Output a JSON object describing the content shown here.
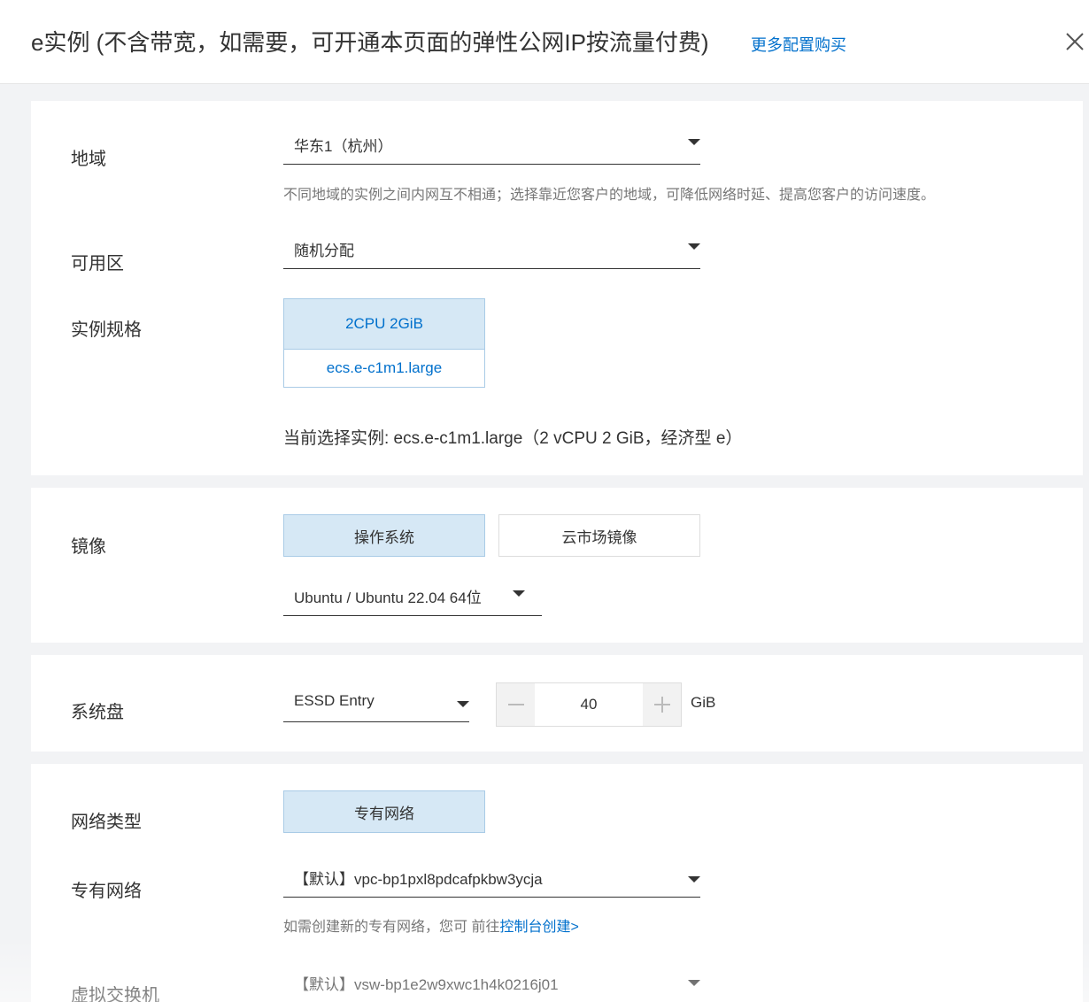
{
  "header": {
    "title": "e实例 (不含带宽，如需要，可开通本页面的弹性公网IP按流量付费)",
    "more_link": "更多配置购买",
    "close_icon": "close-icon"
  },
  "instance": {
    "region": {
      "label": "地域",
      "value": "华东1（杭州）",
      "hint": "不同地域的实例之间内网互不相通；选择靠近您客户的地域，可降低网络时延、提高您客户的访问速度。"
    },
    "zone": {
      "label": "可用区",
      "value": "随机分配"
    },
    "spec": {
      "label": "实例规格",
      "card_title": "2CPU 2GiB",
      "card_type": "ecs.e-c1m1.large",
      "current": "当前选择实例: ecs.e-c1m1.large（2 vCPU 2 GiB，经济型 e）"
    }
  },
  "image": {
    "label": "镜像",
    "tabs": [
      {
        "label": "操作系统",
        "active": true
      },
      {
        "label": "云市场镜像",
        "active": false
      }
    ],
    "os_value": "Ubuntu / Ubuntu 22.04 64位"
  },
  "disk": {
    "label": "系统盘",
    "type_value": "ESSD Entry",
    "size": "40",
    "unit": "GiB",
    "minus_icon": "minus-icon",
    "plus_icon": "plus-icon"
  },
  "network": {
    "type_label": "网络类型",
    "type_value": "专有网络",
    "vpc_label": "专有网络",
    "vpc_value": "【默认】vpc-bp1pxl8pdcafpkbw3ycja",
    "vpc_hint_prefix": "如需创建新的专有网络，您可 前往",
    "vpc_hint_link": "控制台创建>",
    "vswitch_label": "虚拟交换机",
    "vswitch_value": "【默认】vsw-bp1e2w9xwc1h4k0216j01"
  },
  "colors": {
    "accent": "#0070cc",
    "selected_bg": "#d6e8f5",
    "selected_border": "#a9cbe6",
    "page_bg": "#f2f3f5"
  }
}
